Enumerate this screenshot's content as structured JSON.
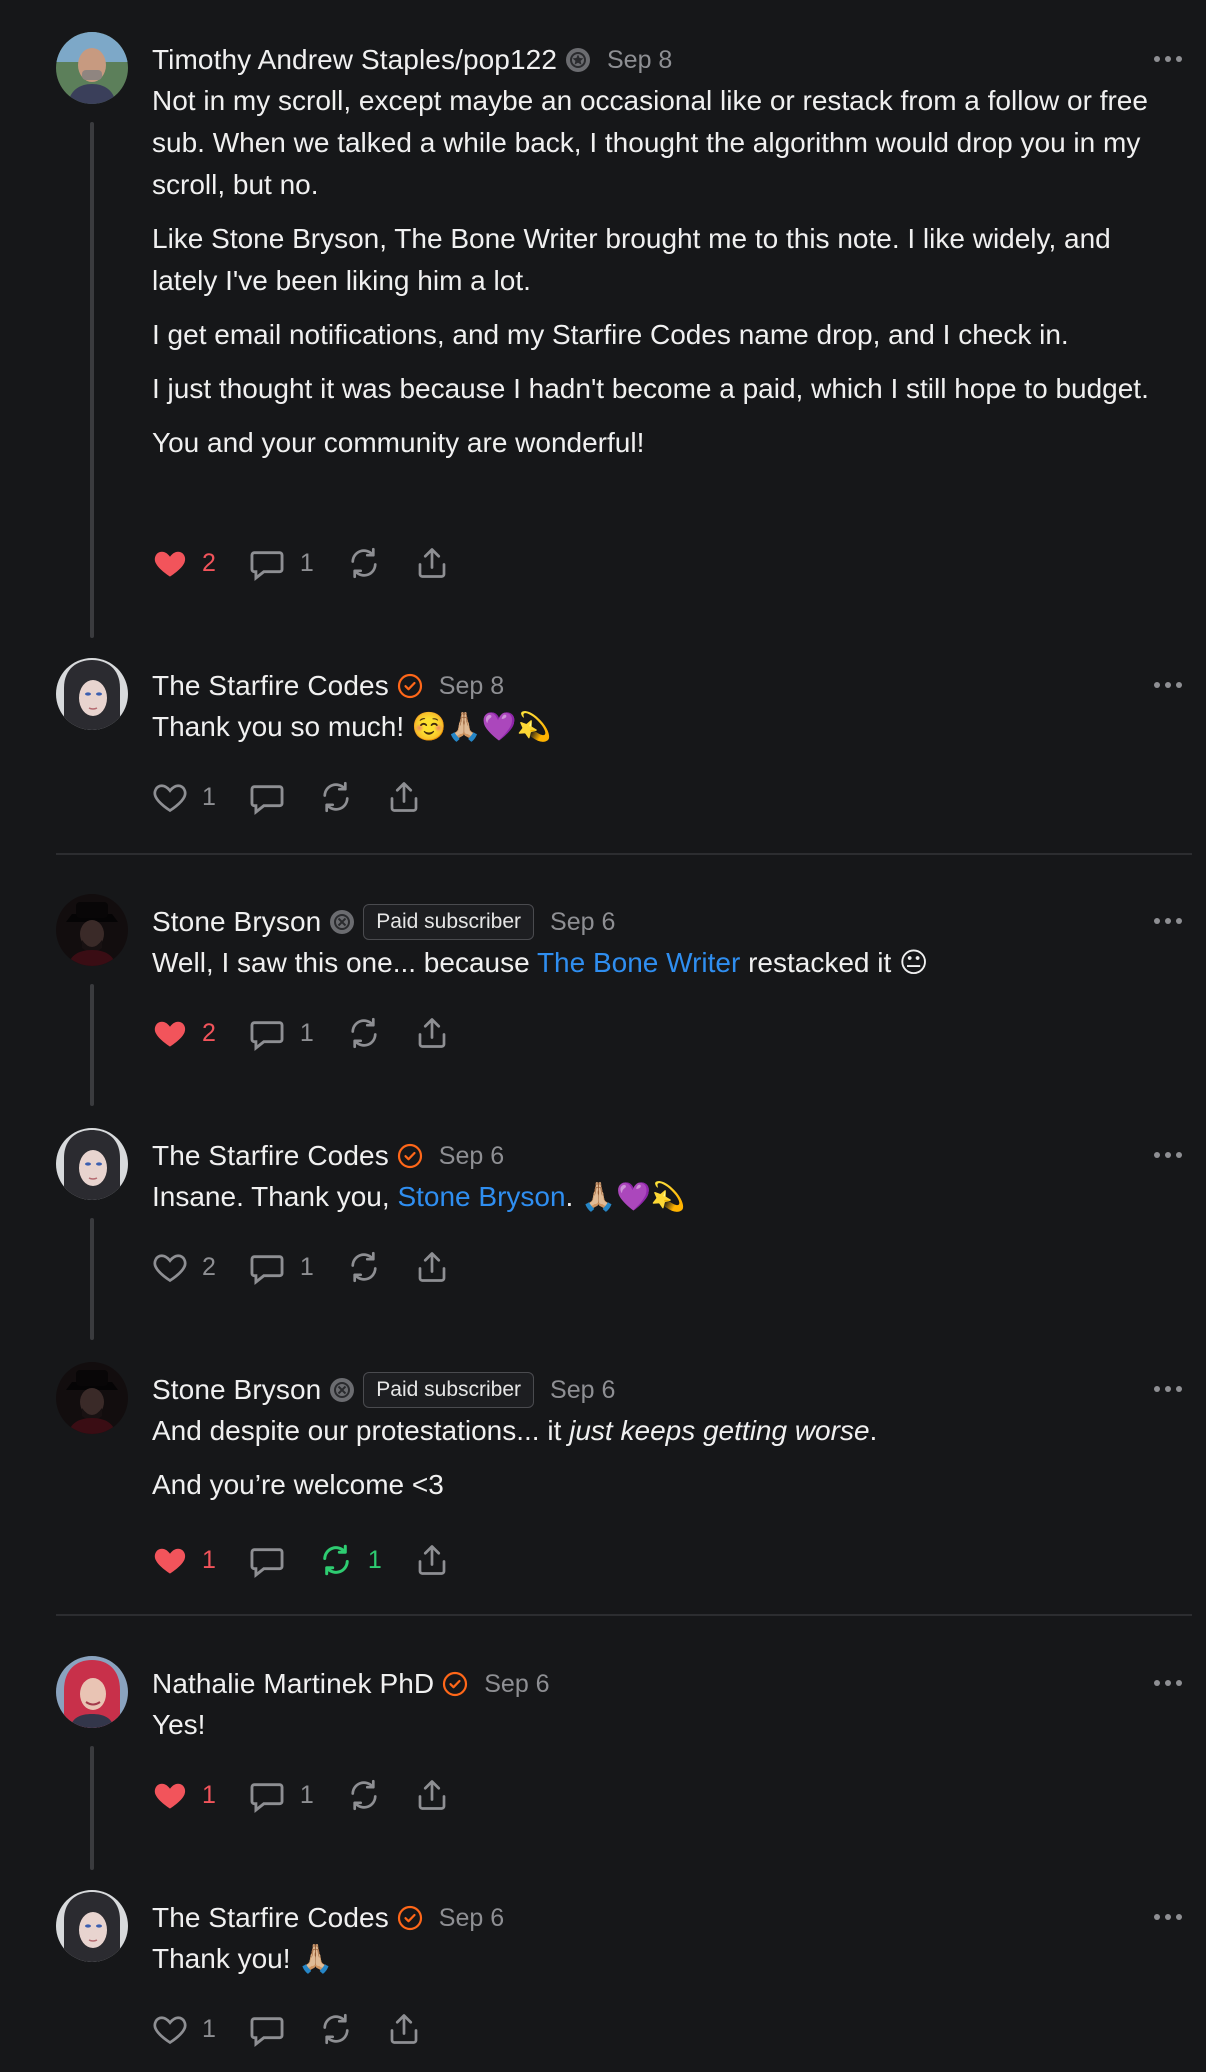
{
  "comments": [
    {
      "author": "Timothy Andrew Staples/pop122",
      "badge": "subscriber-badge-icon",
      "date": "Sep 8",
      "paragraphs": [
        "Not in my scroll, except maybe an occasional like or restack from a follow or free sub. When we talked a while back, I thought the algorithm would drop you in my scroll, but no.",
        "Like Stone Bryson, The Bone Writer brought me to this note. I like widely, and lately I've been liking him a lot.",
        "I get email notifications, and my Starfire Codes name drop, and I check in.",
        "I just thought it was because I hadn't become a paid, which I still hope to budget.",
        "You and your community are wonderful!"
      ],
      "likes": "2",
      "replies": "1",
      "restacks": ""
    },
    {
      "author": "The Starfire Codes",
      "badge": "verified-check-icon",
      "date": "Sep 8",
      "text": "Thank you so much! ☺️🙏🏼💜💫",
      "likes": "1",
      "replies": "",
      "restacks": ""
    },
    {
      "author": "Stone Bryson",
      "badge": "subscriber-badge-icon",
      "paid_label": "Paid subscriber",
      "date": "Sep 6",
      "text_before": "Well, I saw this one... because ",
      "link": "The Bone Writer",
      "text_after": " restacked it 😐",
      "likes": "2",
      "replies": "1",
      "restacks": ""
    },
    {
      "author": "The Starfire Codes",
      "badge": "verified-check-icon",
      "date": "Sep 6",
      "text_before": "Insane. Thank you, ",
      "link": "Stone Bryson",
      "text_after": ". 🙏🏼💜💫",
      "likes": "2",
      "replies": "1",
      "restacks": ""
    },
    {
      "author": "Stone Bryson",
      "badge": "subscriber-badge-icon",
      "paid_label": "Paid subscriber",
      "date": "Sep 6",
      "p1_before": "And despite our protestations... it ",
      "p1_em": "just keeps getting worse",
      "p1_after": ".",
      "p2": "And you’re welcome <3",
      "likes": "1",
      "replies": "",
      "restacks": "1"
    },
    {
      "author": "Nathalie Martinek PhD",
      "badge": "verified-check-icon",
      "date": "Sep 6",
      "text": "Yes!",
      "likes": "1",
      "replies": "1",
      "restacks": ""
    },
    {
      "author": "The Starfire Codes",
      "badge": "verified-check-icon",
      "date": "Sep 6",
      "text": "Thank you! 🙏🏼",
      "likes": "1",
      "replies": "",
      "restacks": ""
    }
  ],
  "colors": {
    "background": "#161719",
    "like_active": "#f2545b",
    "restack_active": "#2ecc71",
    "link": "#2f8ef0",
    "verified": "#ff6719",
    "muted": "#8e8f93"
  }
}
